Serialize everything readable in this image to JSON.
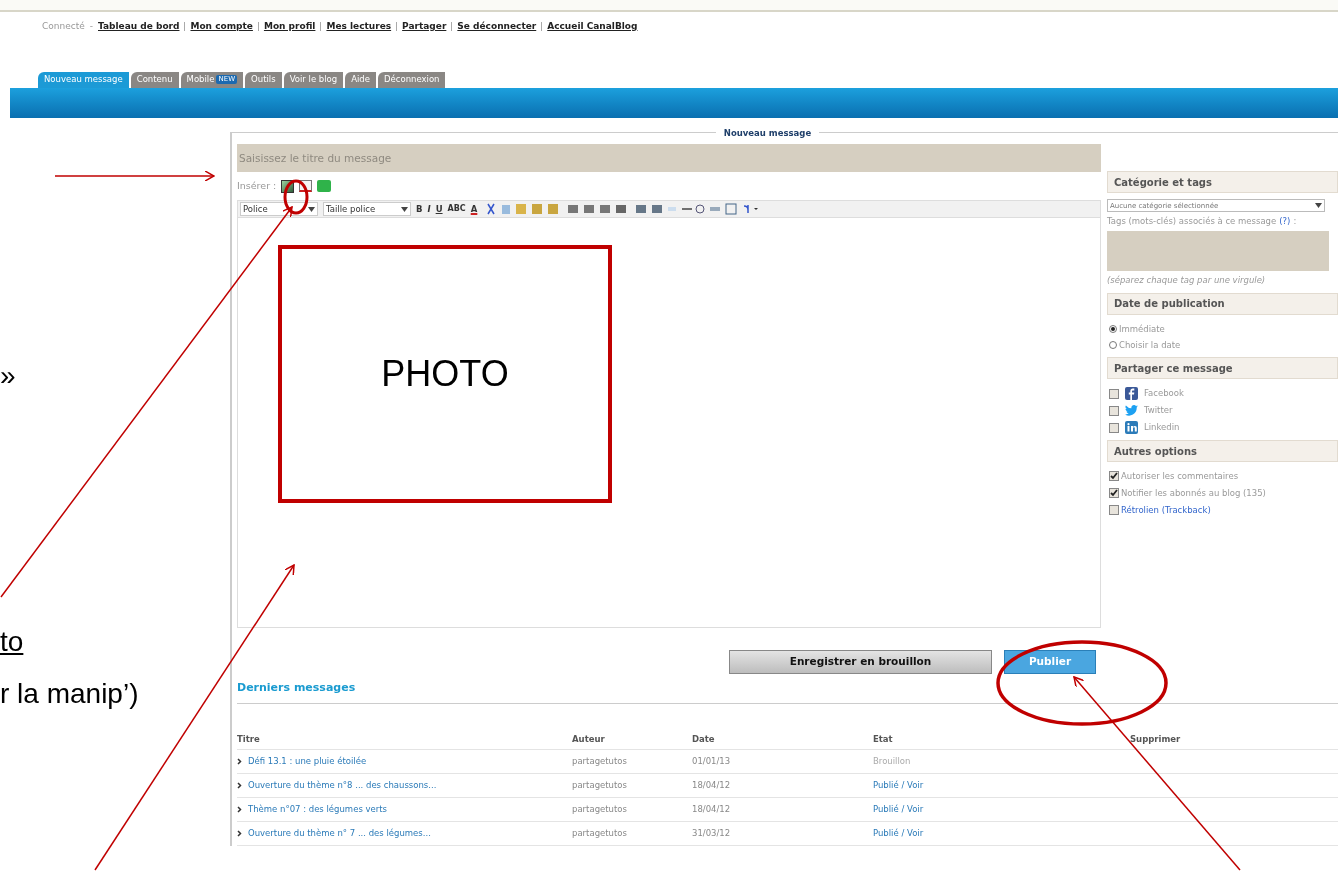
{
  "top_links": {
    "status": "Connecté",
    "separator": "-",
    "links": [
      "Tableau de bord",
      "Mon compte",
      "Mon profil",
      "Mes lectures",
      "Partager",
      "Se déconnecter",
      "Accueil CanalBlog"
    ]
  },
  "tabs": [
    {
      "label": "Nouveau message",
      "selected": true
    },
    {
      "label": "Contenu",
      "selected": false
    },
    {
      "label": "Mobile",
      "selected": false,
      "badge": "NEW"
    },
    {
      "label": "Outils",
      "selected": false
    },
    {
      "label": "Voir le blog",
      "selected": false
    },
    {
      "label": "Aide",
      "selected": false
    },
    {
      "label": "Déconnexion",
      "selected": false
    }
  ],
  "panel_title": "Nouveau message",
  "title_field": {
    "placeholder": "Saisissez le titre du message"
  },
  "insert_label": "Insérer :",
  "toolbar": {
    "font": "Police",
    "size": "Taille police",
    "format": [
      "B",
      "I",
      "U",
      "ABC",
      "A"
    ]
  },
  "editor": {
    "placeholder_box": "PHOTO"
  },
  "sidebar": [
    {
      "kind": "category",
      "title": "Catégorie et tags",
      "select": "Aucune catégorie sélectionnée",
      "tags_label": "Tags (mots-clés) associés à ce message",
      "help": "(?)",
      "colon": ":",
      "hint": "(séparez chaque tag par une virgule)"
    },
    {
      "kind": "radios",
      "title": "Date de publication",
      "options": [
        {
          "label": "Immédiate",
          "selected": true
        },
        {
          "label": "Choisir la date",
          "selected": false
        }
      ]
    },
    {
      "kind": "checks",
      "title": "Partager ce message",
      "options": [
        {
          "label": "Facebook",
          "checked": false,
          "kind": "facebook"
        },
        {
          "label": "Twitter",
          "checked": false,
          "kind": "twitter"
        },
        {
          "label": "Linkedin",
          "checked": false,
          "kind": "linkedin"
        }
      ]
    },
    {
      "kind": "checks",
      "title": "Autres options",
      "options": [
        {
          "label": "Autoriser les commentaires",
          "checked": true,
          "kind": "plain"
        },
        {
          "label": "Notifier les abonnés au blog (135)",
          "checked": true,
          "kind": "plain"
        },
        {
          "label": "Rétrolien (Trackback)",
          "checked": false,
          "kind": "link"
        }
      ]
    }
  ],
  "buttons": {
    "draft": "Enregistrer en brouillon",
    "publish": "Publier"
  },
  "recent": {
    "title": "Derniers messages",
    "columns": [
      "Titre",
      "Auteur",
      "Date",
      "Etat",
      "Supprimer"
    ],
    "rows": [
      {
        "title": "Défi 13.1 : une pluie étoilée",
        "author": "partagetutos",
        "date": "01/01/13",
        "state": "Brouillon",
        "kind": "draft"
      },
      {
        "title": "Ouverture du thème n°8 ... des chaussons...",
        "author": "partagetutos",
        "date": "18/04/12",
        "state": "Publié / Voir",
        "kind": "published"
      },
      {
        "title": "Thème n°07 : des légumes verts",
        "author": "partagetutos",
        "date": "18/04/12",
        "state": "Publié / Voir",
        "kind": "published"
      },
      {
        "title": "Ouverture du thème n° 7 ... des légumes...",
        "author": "partagetutos",
        "date": "31/03/12",
        "state": "Publié / Voir",
        "kind": "published"
      }
    ]
  },
  "annotations": {
    "fragments": [
      {
        "text": "»",
        "kind": "plain"
      },
      {
        "text": "to",
        "kind": "underlined"
      },
      {
        "text": "r la manip’)",
        "kind": "plain"
      }
    ]
  }
}
